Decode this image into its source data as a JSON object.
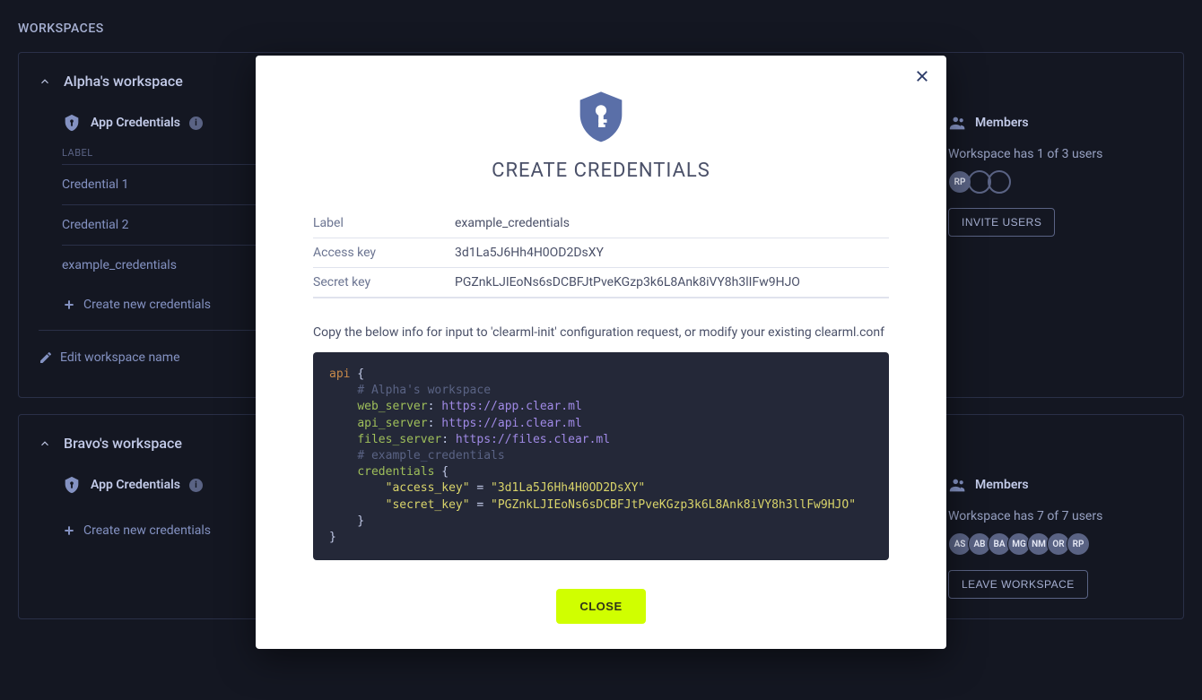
{
  "page_title": "WORKSPACES",
  "workspaces": [
    {
      "name": "Alpha's workspace",
      "app_credentials_title": "App Credentials",
      "label_heading": "LABEL",
      "credentials": [
        "Credential 1",
        "Credential 2",
        "example_credentials"
      ],
      "create_new_label": "Create new credentials",
      "edit_name_label": "Edit workspace name",
      "members_title": "Members",
      "members_count_text": "Workspace has 1 of 3 users",
      "avatars": [
        "RP"
      ],
      "empty_avatars": 2,
      "primary_button": "INVITE USERS"
    },
    {
      "name": "Bravo's workspace",
      "app_credentials_title": "App Credentials",
      "create_new_label": "Create new credentials",
      "members_title": "Members",
      "members_count_text": "Workspace has 7 of 7 users",
      "avatars": [
        "AS",
        "AB",
        "BA",
        "MG",
        "NM",
        "OR",
        "RP"
      ],
      "primary_button": "LEAVE WORKSPACE"
    }
  ],
  "modal": {
    "title": "CREATE CREDENTIALS",
    "rows": {
      "label_l": "Label",
      "label_v": "example_credentials",
      "access_l": "Access key",
      "access_v": "3d1La5J6Hh4H0OD2DsXY",
      "secret_l": "Secret key",
      "secret_v": "PGZnkLJIEoNs6sDCBFJtPveKGzp3k6L8Ank8iVY8h3lIFw9HJO"
    },
    "copy_note": "Copy the below info for input to 'clearml-init' configuration request, or modify your existing clearml.conf",
    "code": {
      "api": "api",
      "comment_ws": "# Alpha's workspace",
      "web_server_k": "web_server",
      "web_server_v": "https://app.clear.ml",
      "api_server_k": "api_server",
      "api_server_v": "https://api.clear.ml",
      "files_server_k": "files_server",
      "files_server_v": "https://files.clear.ml",
      "comment_cred": "# example_credentials",
      "credentials_k": "credentials",
      "access_key_k": "\"access_key\"",
      "access_key_v": "\"3d1La5J6Hh4H0OD2DsXY\"",
      "secret_key_k": "\"secret_key\"",
      "secret_key_v": "\"PGZnkLJIEoNs6sDCBFJtPveKGzp3k6L8Ank8iVY8h3llFw9HJO\""
    },
    "close_label": "CLOSE"
  }
}
